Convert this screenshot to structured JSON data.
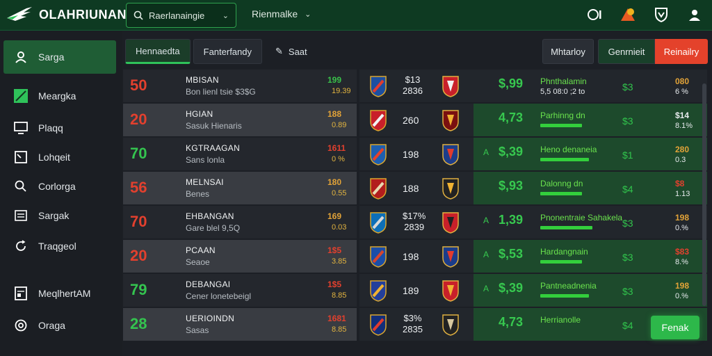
{
  "brand": {
    "name": "OLAHRIUNAN"
  },
  "search": {
    "label": "Raerlanaingie"
  },
  "top_menu": {
    "label": "Rienmalke"
  },
  "top_icons": [
    "fullscreen-icon",
    "notification-icon",
    "shield-icon",
    "user-icon"
  ],
  "sidebar": {
    "items": [
      {
        "label": "Sarga",
        "icon": "user-icon",
        "active": true
      },
      {
        "label": "Meargka",
        "icon": "flag-icon",
        "active": false
      },
      {
        "label": "Plaqq",
        "icon": "desktop-icon",
        "active": false
      },
      {
        "label": "Lohqeit",
        "icon": "checkbox-icon",
        "active": false
      },
      {
        "label": "Corlorga",
        "icon": "search-icon",
        "active": false
      },
      {
        "label": "Sargak",
        "icon": "list-icon",
        "active": false
      },
      {
        "label": "Traqgeol",
        "icon": "refresh-icon",
        "active": false
      },
      {
        "label": "MeqlhertAM",
        "icon": "document-icon",
        "active": false
      },
      {
        "label": "Oraga",
        "icon": "settings-icon",
        "active": false
      }
    ]
  },
  "tabs": [
    {
      "label": "Hennaedta",
      "active": true
    },
    {
      "label": "Fanterfandy",
      "active": false
    },
    {
      "label": "Saat",
      "active": false
    }
  ],
  "actions": {
    "filter": "Mhtarloy",
    "market": "Genrnieit",
    "remove": "Reinailry"
  },
  "place_button": "Fenak",
  "colors": {
    "accent_green": "#2fc25a",
    "danger_red": "#e4422b",
    "odds_gold": "#e2b440"
  },
  "rows": [
    {
      "score": "50",
      "score_color": "red",
      "name": "MBISAN",
      "sub": "Bon lienl tsie $3$G",
      "odd1": "199",
      "odd1_color": "#39c24a",
      "odd2": "19.39",
      "num": "$13",
      "num2": "2836",
      "price": "$,99",
      "arrow": "",
      "market": "Phnthalamin",
      "market_sub": "5,5 08:0 ;2 to",
      "bar": 0,
      "m3": "$3",
      "r1": "080",
      "r1_color": "#e2a338",
      "r2": "6 %",
      "hl": false
    },
    {
      "score": "20",
      "score_color": "red",
      "name": "HGIAN",
      "sub": "Sasuk Hienaris",
      "odd1": "188",
      "odd1_color": "#e2a338",
      "odd2": "0.89",
      "num": "260",
      "num2": "",
      "price": "4,73",
      "arrow": "",
      "market": "Parhinng dn",
      "market_sub": "",
      "bar": 0.6,
      "m3": "$3",
      "r1": "$14",
      "r1_color": "#e6eaed",
      "r2": "8.1%",
      "hl": true
    },
    {
      "score": "70",
      "score_color": "green",
      "name": "KGTRAAGAN",
      "sub": "Sans lonla",
      "odd1": "1611",
      "odd1_color": "#e2402e",
      "odd2": "0 %",
      "num": "198",
      "num2": "",
      "price": "$,39",
      "arrow": "A",
      "market": "Heno denaneia",
      "market_sub": "",
      "bar": 0.7,
      "m3": "$1",
      "r1": "280",
      "r1_color": "#e2a338",
      "r2": "0.3",
      "hl": true
    },
    {
      "score": "56",
      "score_color": "red",
      "name": "MELNSAI",
      "sub": "Benes",
      "odd1": "180",
      "odd1_color": "#e2a338",
      "odd2": "0.55",
      "num": "188",
      "num2": "",
      "price": "$,93",
      "arrow": "",
      "market": "Dalonng dn",
      "market_sub": "",
      "bar": 0.6,
      "m3": "$4",
      "r1": "$8",
      "r1_color": "#e2402e",
      "r2": "1.13",
      "hl": true
    },
    {
      "score": "70",
      "score_color": "red",
      "name": "EHBANGAN",
      "sub": "Gare blel 9,5Q",
      "odd1": "169",
      "odd1_color": "#e2a338",
      "odd2": "0.03",
      "num": "$17%",
      "num2": "2839",
      "price": "1,39",
      "arrow": "A",
      "market": "Pnonentraie Sahakela",
      "market_sub": "",
      "bar": 0.75,
      "m3": "$3",
      "r1": "198",
      "r1_color": "#e2a338",
      "r2": "0.%",
      "hl": false
    },
    {
      "score": "20",
      "score_color": "red",
      "name": "PCAAN",
      "sub": "Seaoe",
      "odd1": "1$5",
      "odd1_color": "#e2402e",
      "odd2": "3.85",
      "num": "198",
      "num2": "",
      "price": "$,53",
      "arrow": "A",
      "market": "Hardangnain",
      "market_sub": "",
      "bar": 0.6,
      "m3": "$3",
      "r1": "$83",
      "r1_color": "#e2402e",
      "r2": "8.%",
      "hl": true
    },
    {
      "score": "79",
      "score_color": "green",
      "name": "DEBANGAI",
      "sub": "Cener lonetebeigl",
      "odd1": "1$5",
      "odd1_color": "#e2402e",
      "odd2": "8.85",
      "num": "189",
      "num2": "",
      "price": "$,39",
      "arrow": "A",
      "market": "Pantneadnenia",
      "market_sub": "",
      "bar": 0.7,
      "m3": "$3",
      "r1": "198",
      "r1_color": "#e2a338",
      "r2": "0.%",
      "hl": true
    },
    {
      "score": "28",
      "score_color": "green",
      "name": "UERIOINDN",
      "sub": "Sasas",
      "odd1": "1681",
      "odd1_color": "#e2402e",
      "odd2": "8.85",
      "num": "$3%",
      "num2": "2835",
      "price": "4,73",
      "arrow": "",
      "market": "Herrianolle",
      "market_sub": "",
      "bar": 0,
      "m3": "$4",
      "r1": "",
      "r1_color": "#e6eaed",
      "r2": "",
      "hl": true
    }
  ]
}
